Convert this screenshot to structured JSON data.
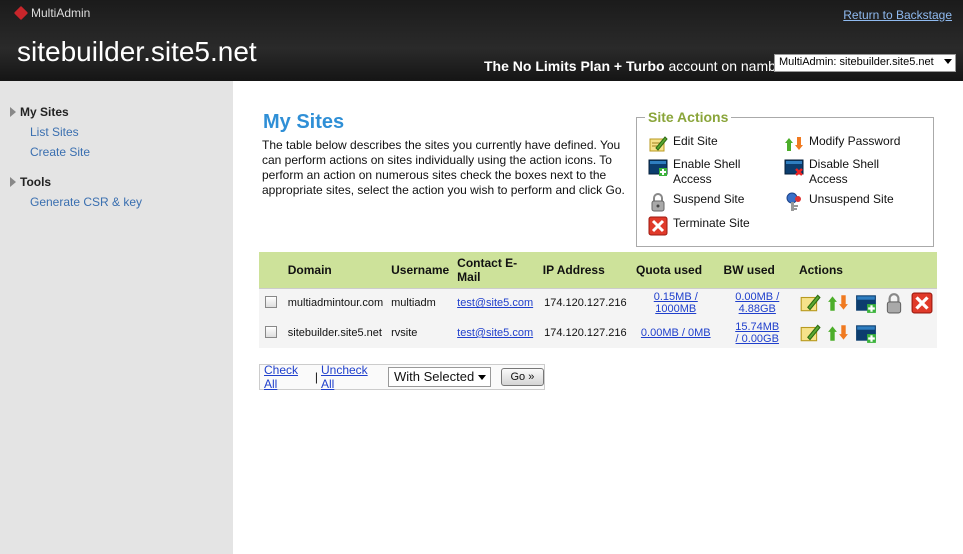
{
  "header": {
    "brand": "MultiAdmin",
    "return_link": "Return to Backstage",
    "site_title": "sitebuilder.site5.net",
    "plan_name": "The No Limits Plan + Turbo",
    "plan_suffix": " account on namber",
    "account_select_value": "MultiAdmin: sitebuilder.site5.net"
  },
  "sidebar": {
    "sections": [
      {
        "title": "My Sites",
        "links": [
          "List Sites",
          "Create Site"
        ]
      },
      {
        "title": "Tools",
        "links": [
          "Generate CSR & key"
        ]
      }
    ]
  },
  "main": {
    "title": "My Sites",
    "intro": "The table below describes the sites you currently have defined. You can perform actions on sites individually using the action icons. To perform an action on numerous sites check the boxes next to the appropriate sites, select the action you wish to perform and click Go."
  },
  "site_actions": {
    "legend": "Site Actions",
    "items": [
      {
        "label": "Edit Site",
        "icon": "edit-icon"
      },
      {
        "label": "Modify Password",
        "icon": "password-icon"
      },
      {
        "label": "Enable Shell Access",
        "icon": "shell-enable-icon"
      },
      {
        "label": "Disable Shell Access",
        "icon": "shell-disable-icon"
      },
      {
        "label": "Suspend Site",
        "icon": "lock-icon"
      },
      {
        "label": "Unsuspend Site",
        "icon": "unlock-icon"
      },
      {
        "label": "Terminate Site",
        "icon": "terminate-icon"
      }
    ]
  },
  "table": {
    "headers": [
      "Domain",
      "Username",
      "Contact E-Mail",
      "IP Address",
      "Quota used",
      "BW used",
      "Actions"
    ],
    "rows": [
      {
        "domain": "multiadmintour.com",
        "username": "multiadm",
        "email": "test@site5.com",
        "ip": "174.120.127.216",
        "quota": "0.15MB / 1000MB",
        "bw": "0.00MB / 4.88GB"
      },
      {
        "domain": "sitebuilder.site5.net",
        "username": "rvsite",
        "email": "test@site5.com",
        "ip": "174.120.127.216",
        "quota": "0.00MB / 0MB",
        "bw": "15.74MB / 0.00GB"
      }
    ]
  },
  "bulk": {
    "check_all": "Check All",
    "separator": "|",
    "uncheck_all": "Uncheck All",
    "select_value": "With Selected",
    "go": "Go »"
  },
  "colors": {
    "header_bg": "#1f1f1f",
    "title_blue": "#2f8fd6",
    "table_header_green": "#cde29a",
    "legend_green": "#8aa53a",
    "link_blue": "#1f3fcc"
  }
}
